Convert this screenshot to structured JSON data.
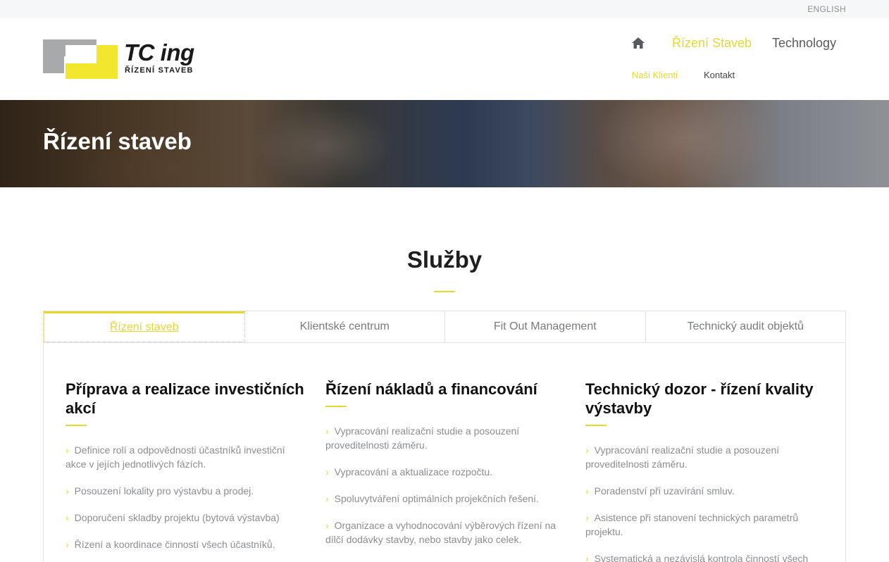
{
  "topbar": {
    "language": "ENGLISH"
  },
  "header": {
    "logo": {
      "name": "TC ing",
      "subtitle": "ŘÍZENÍ STAVEB"
    },
    "nav": {
      "home_icon": "home-icon",
      "main": [
        {
          "label": "Řízení Staveb"
        },
        {
          "label": "Technology"
        }
      ],
      "sub": [
        {
          "label": "Naši Klienti"
        },
        {
          "label": "Kontakt"
        }
      ]
    }
  },
  "hero": {
    "title": "Řízení staveb"
  },
  "services": {
    "title": "Služby",
    "tabs": [
      {
        "label": "Řízení staveb"
      },
      {
        "label": "Klientské centrum"
      },
      {
        "label": "Fit Out Management"
      },
      {
        "label": "Technický audit objektů"
      }
    ],
    "columns": [
      {
        "heading": "Příprava a realizace investičních akcí",
        "items": [
          "Definice rolí a odpovědnosti účastníků investiční akce v jejích jednotlivých fázích.",
          "Posouzení lokality pro výstavbu a prodej.",
          "Doporučení skladby projektu (bytová výstavba)",
          "Řízení a koordinace činností všech účastníků."
        ]
      },
      {
        "heading": "Řízení nákladů a financování",
        "items": [
          "Vypracování realizační studie a posouzení proveditelnosti záměru.",
          "Vypracování a aktualizace rozpočtu.",
          "Spoluvytváření optimálních projekčních řešení.",
          "Organizace a vyhodnocování výběrových řízení na dílčí dodávky stavby, nebo stavby jako celek."
        ]
      },
      {
        "heading": "Technický dozor - řízení kvality výstavby",
        "items": [
          "Vypracování realizační studie a posouzení proveditelnosti záměru.",
          "Poradenství při uzavírání smluv.",
          "Asistence při stanovení technických parametrů projektu.",
          "Systematická a nezávislá kontrola činností všech"
        ]
      }
    ]
  },
  "colors": {
    "accent": "#e6d82c",
    "logo_grey": "#a8a9ab",
    "logo_yellow": "#f2e62e"
  }
}
